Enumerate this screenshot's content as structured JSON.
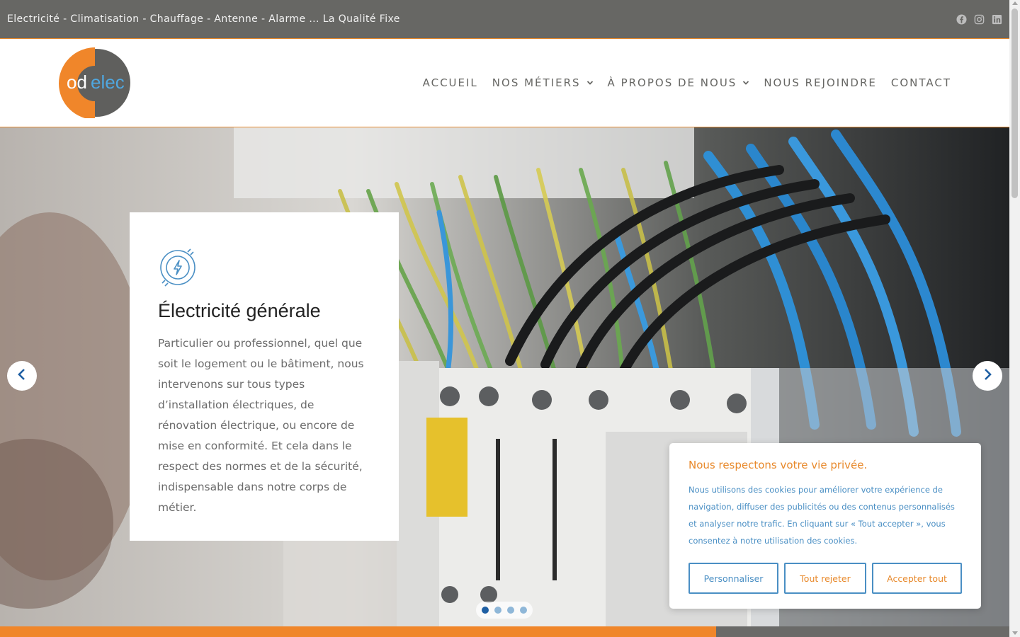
{
  "topbar": {
    "tagline": "Electricité - Climatisation - Chauffage - Antenne - Alarme ... La Qualité Fixe",
    "social": [
      {
        "icon": "facebook-icon"
      },
      {
        "icon": "instagram-icon"
      },
      {
        "icon": "linkedin-icon"
      }
    ]
  },
  "header": {
    "logo_prefix": "od",
    "logo_suffix": "elec",
    "nav": [
      {
        "label": "ACCUEIL",
        "has_dropdown": false
      },
      {
        "label": "NOS MÉTIERS",
        "has_dropdown": true
      },
      {
        "label": "À PROPOS DE NOUS",
        "has_dropdown": true
      },
      {
        "label": "NOUS REJOINDRE",
        "has_dropdown": false
      },
      {
        "label": "CONTACT",
        "has_dropdown": false
      }
    ]
  },
  "hero": {
    "card": {
      "icon": "electric-plug-icon",
      "title": "Électricité générale",
      "text": "Particulier ou professionnel, quel que soit le logement ou le bâtiment, nous intervenons sur tous types d’installation électriques, de rénovation électrique, ou encore de mise en conformité. Et cela dans le respect des normes et de la sécurité, indispensable dans notre corps de métier."
    },
    "slides_count": 4,
    "active_slide": 1
  },
  "cookie": {
    "title": "Nous respectons votre vie privée.",
    "text": "Nous utilisons des cookies pour améliorer votre expérience de navigation, diffuser des publicités ou des contenus personnalisés et analyser notre trafic. En cliquant sur « Tout accepter », vous consentez à notre utilisation des cookies.",
    "customize_label": "Personnaliser",
    "reject_label": "Tout rejeter",
    "accept_label": "Accepter tout"
  },
  "colors": {
    "accent_orange": "#e8892b",
    "accent_blue": "#4a8fc4",
    "topbar_gray": "#676764"
  }
}
